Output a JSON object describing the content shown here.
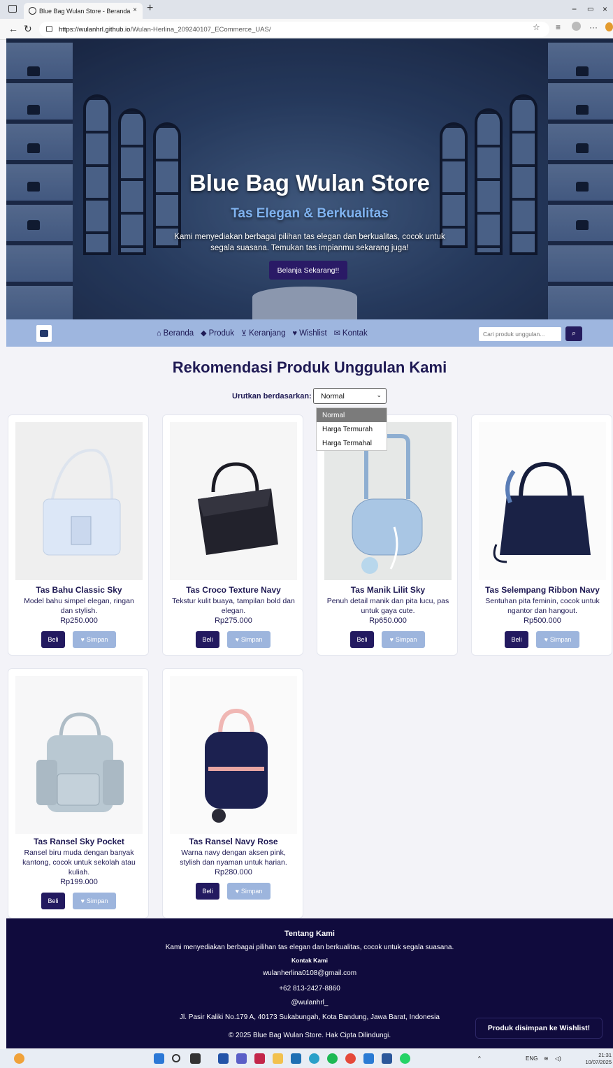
{
  "browser": {
    "tab_title": "Blue Bag Wulan Store - Beranda",
    "tab_close": "×",
    "new_tab": "+",
    "url_host": "https://wulanhrl.github.io",
    "url_path": "/Wulan-Herlina_209240107_ECommerce_UAS/",
    "minimize": "−",
    "restore": "ⓓ",
    "close": "×"
  },
  "hero": {
    "title": "Blue Bag Wulan Store",
    "subtitle": "Tas Elegan & Berkualitas",
    "description": "Kami menyediakan berbagai pilihan tas elegan dan berkualitas, cocok untuk segala suasana. Temukan tas impianmu sekarang juga!",
    "button": "Belanja Sekarang!!"
  },
  "navbar": {
    "links": [
      {
        "label": "Beranda",
        "icon": "home-icon"
      },
      {
        "label": "Produk",
        "icon": "bag-icon"
      },
      {
        "label": "Keranjang",
        "icon": "cart-icon"
      },
      {
        "label": "Wishlist",
        "icon": "heart-icon"
      },
      {
        "label": "Kontak",
        "icon": "envelope-icon"
      }
    ],
    "search_placeholder": "Cari produk unggulan..."
  },
  "section": {
    "title": "Rekomendasi Produk Unggulan Kami",
    "sort_label": "Urutkan berdasarkan:",
    "sort_value": "Normal",
    "sort_options": [
      "Normal",
      "Harga Termurah",
      "Harga Termahal"
    ]
  },
  "products": [
    {
      "name": "Tas Bahu Classic Sky",
      "desc": "Model bahu simpel elegan, ringan dan stylish.",
      "price": "Rp250.000",
      "buy": "Beli",
      "save": "Simpan"
    },
    {
      "name": "Tas Croco Texture Navy",
      "desc": "Tekstur kulit buaya, tampilan bold dan elegan.",
      "price": "Rp275.000",
      "buy": "Beli",
      "save": "Simpan"
    },
    {
      "name": "Tas Manik Lilit Sky",
      "desc": "Penuh detail manik dan pita lucu, pas untuk gaya cute.",
      "price": "Rp650.000",
      "buy": "Beli",
      "save": "Simpan"
    },
    {
      "name": "Tas Selempang Ribbon Navy",
      "desc": "Sentuhan pita feminin, cocok untuk ngantor dan hangout.",
      "price": "Rp500.000",
      "buy": "Beli",
      "save": "Simpan"
    },
    {
      "name": "Tas Ransel Sky Pocket",
      "desc": "Ransel biru muda dengan banyak kantong, cocok untuk sekolah atau kuliah.",
      "price": "Rp199.000",
      "buy": "Beli",
      "save": "Simpan"
    },
    {
      "name": "Tas Ransel Navy Rose",
      "desc": "Warna navy dengan aksen pink, stylish dan nyaman untuk harian.",
      "price": "Rp280.000",
      "buy": "Beli",
      "save": "Simpan"
    }
  ],
  "footer": {
    "about_title": "Tentang Kami",
    "about_text": "Kami menyediakan berbagai pilihan tas elegan dan berkualitas, cocok untuk segala suasana.",
    "contact_title": "Kontak Kami",
    "email": "wulanherlina0108@gmail.com",
    "phone": "+62 813-2427-8860",
    "instagram": "@wulanhrl_",
    "address": "Jl. Pasir Kaliki No.179 A, 40173 Sukabungah, Kota Bandung, Jawa Barat, Indonesia",
    "copyright": "© 2025 Blue Bag Wulan Store. Hak Cipta Dilindungi."
  },
  "toast": "Produk disimpan ke Wishlist!",
  "taskbar": {
    "lang": "ENG",
    "time": "21:31",
    "date": "10/07/2025"
  },
  "colors": {
    "navy": "#100b3d",
    "button_primary": "#231a60",
    "button_secondary": "#9db5dd",
    "navbar": "#9eb6df"
  }
}
